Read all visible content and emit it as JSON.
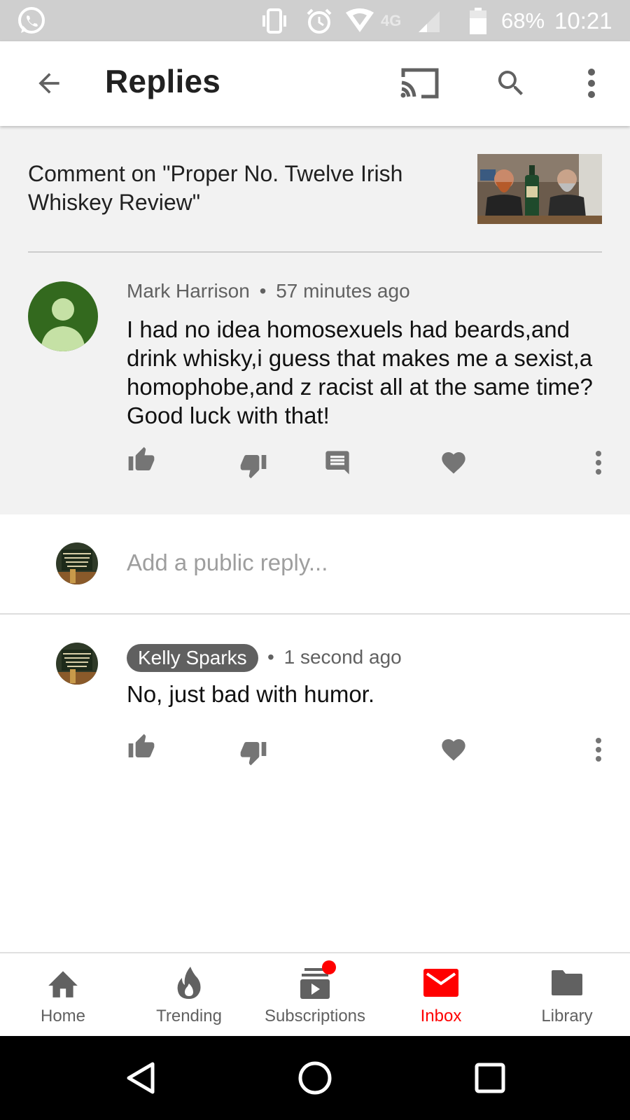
{
  "status_bar": {
    "battery": "68%",
    "time": "10:21",
    "network": "4G"
  },
  "app_bar": {
    "title": "Replies",
    "icons": [
      "back-arrow-icon",
      "cast-icon",
      "search-icon",
      "more-vert-icon"
    ]
  },
  "thread": {
    "video_title": "Comment on \"Proper No. Twelve Irish Whiskey Review\"",
    "comment": {
      "author": "Mark Harrison",
      "separator": "•",
      "time": "57 minutes ago",
      "text": "I had no idea homosexuels had beards,and drink whisky,i guess that makes me a sexist,a homophobe,and z racist all at the same time?Good luck with that!",
      "avatar_color": "#33691e"
    }
  },
  "reply_box": {
    "placeholder": "Add a public reply..."
  },
  "reply": {
    "author": "Kelly Sparks",
    "separator": "•",
    "time": "1 second ago",
    "text": "No, just bad with humor."
  },
  "bottom_nav": {
    "items": [
      {
        "label": "Home",
        "icon": "home-icon"
      },
      {
        "label": "Trending",
        "icon": "trending-flame-icon"
      },
      {
        "label": "Subscriptions",
        "icon": "subscriptions-icon"
      },
      {
        "label": "Inbox",
        "icon": "inbox-icon"
      },
      {
        "label": "Library",
        "icon": "library-folder-icon"
      }
    ],
    "active": "Inbox",
    "accent_color": "#ff0000",
    "subscriptions_badge": true
  },
  "colors": {
    "status_bar": "#cfcfcf",
    "thread_bg": "#f2f2f2",
    "accent": "#ff0000",
    "icon_gray": "#616161"
  }
}
